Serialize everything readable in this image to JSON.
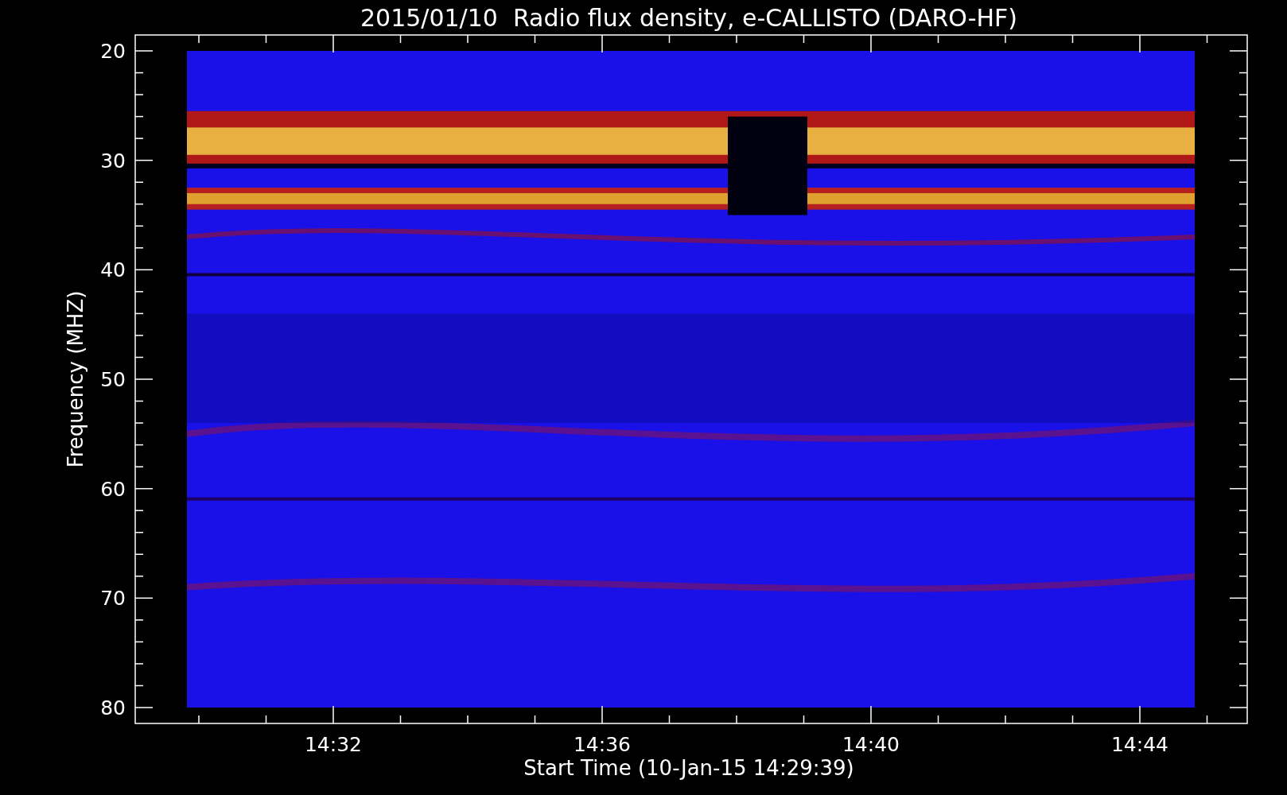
{
  "title": "2015/01/10  Radio flux density, e-CALLISTO (DARO-HF)",
  "yaxis": {
    "label": "Frequency (MHZ)",
    "ticks": [
      "20",
      "30",
      "40",
      "50",
      "60",
      "70",
      "80"
    ]
  },
  "xaxis": {
    "label": "Start Time (10-Jan-15 14:29:39)",
    "ticks": [
      "14:32",
      "14:36",
      "14:40",
      "14:44"
    ]
  }
}
